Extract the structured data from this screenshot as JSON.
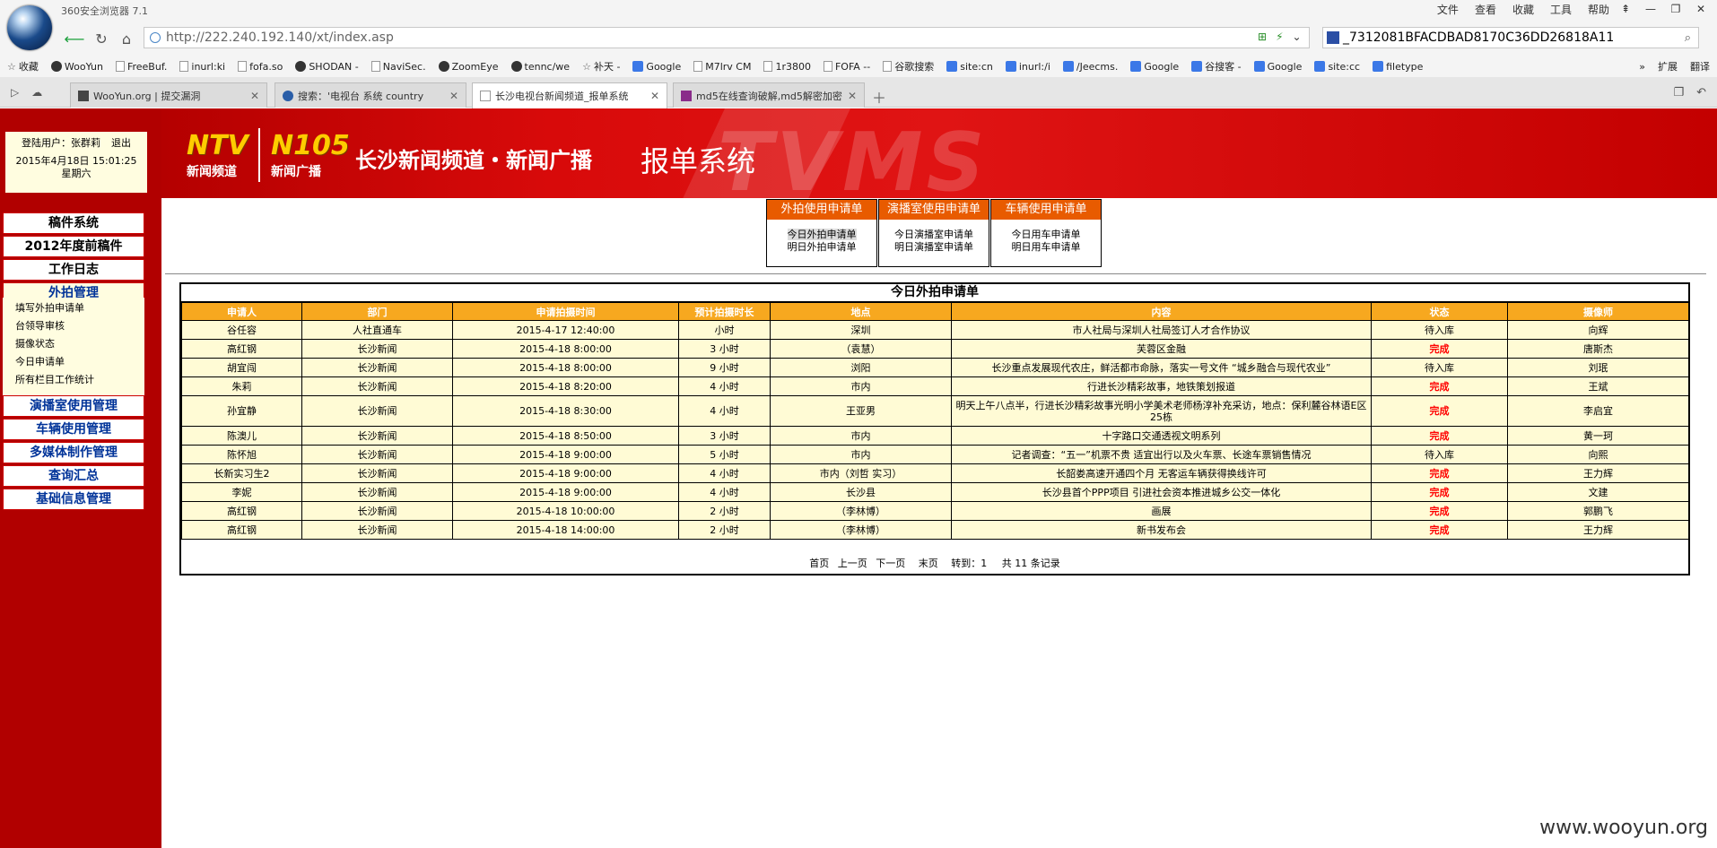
{
  "browser": {
    "title": "360安全浏览器 7.1",
    "menu": [
      "文件",
      "查看",
      "收藏",
      "工具",
      "帮助"
    ],
    "url": "http://222.240.192.140/xt/index.asp",
    "search_value": "_7312081BFACDBAD8170C36DD26818A11",
    "bookmarks": [
      {
        "label": "收藏",
        "icon": "star-icon"
      },
      {
        "label": "WooYun",
        "icon": "wooyun-icon"
      },
      {
        "label": "FreeBuf.",
        "icon": "freebuf-icon"
      },
      {
        "label": "inurl:ki",
        "icon": "page-icon"
      },
      {
        "label": "fofa.so",
        "icon": "page-icon"
      },
      {
        "label": "SHODAN -",
        "icon": "shodan-icon"
      },
      {
        "label": "NaviSec.",
        "icon": "page-icon"
      },
      {
        "label": "ZoomEye",
        "icon": "zoomeye-icon"
      },
      {
        "label": "tennc/we",
        "icon": "github-icon"
      },
      {
        "label": "补天 -",
        "icon": "butian-icon"
      },
      {
        "label": "Google",
        "icon": "google-icon"
      },
      {
        "label": "M7lrv CM",
        "icon": "page-icon"
      },
      {
        "label": "1r3800",
        "icon": "page-icon"
      },
      {
        "label": "FOFA --",
        "icon": "page-icon"
      },
      {
        "label": "谷歌搜索",
        "icon": "page-icon"
      },
      {
        "label": "site:cn",
        "icon": "google-icon"
      },
      {
        "label": "inurl:/i",
        "icon": "google-icon"
      },
      {
        "label": "/Jeecms.",
        "icon": "google-icon"
      },
      {
        "label": "Google",
        "icon": "google-icon"
      },
      {
        "label": "谷搜客 -",
        "icon": "google-icon"
      },
      {
        "label": "Google",
        "icon": "google-icon"
      },
      {
        "label": "site:cc",
        "icon": "google-icon"
      },
      {
        "label": "filetype",
        "icon": "google-icon"
      }
    ],
    "bookmarks_right": [
      "扩展",
      "翻译"
    ],
    "tabs": [
      {
        "label": "WooYun.org | 提交漏洞",
        "active": false
      },
      {
        "label": "搜索：'电视台 系统 country",
        "active": false
      },
      {
        "label": "长沙电视台新闻频道_报单系统",
        "active": true
      },
      {
        "label": "md5在线查询破解,md5解密加密",
        "active": false
      }
    ]
  },
  "banner": {
    "logo1_big": "NTV",
    "logo1_small": "新闻频道",
    "logo2_big": "N105",
    "logo2_small": "新闻广播",
    "title": "长沙新闻频道・新闻广播",
    "system": "报单系统",
    "watermark_text": "TVMS"
  },
  "sidebar": {
    "login_label": "登陆用户：张群莉",
    "logout": "退出",
    "date": "2015年4月18日 15:01:25",
    "weekday": "星期六",
    "menu_top": [
      "稿件系统",
      "2012年度前稿件",
      "工作日志"
    ],
    "waipai_header": "外拍管理",
    "waipai_items": [
      "填写外拍申请单",
      "台领导审核",
      "摄像状态",
      "今日申请单",
      "所有栏目工作统计"
    ],
    "menu_bottom": [
      "演播室使用管理",
      "车辆使用管理",
      "多媒体制作管理",
      "查询汇总",
      "基础信息管理"
    ]
  },
  "quick": [
    {
      "header": "外拍使用申请单",
      "links": [
        "今日外拍申请单",
        "明日外拍申请单"
      ]
    },
    {
      "header": "演播室使用申请单",
      "links": [
        "今日演播室申请单",
        "明日演播室申请单"
      ]
    },
    {
      "header": "车辆使用申请单",
      "links": [
        "今日用车申请单",
        "明日用车申请单"
      ]
    }
  ],
  "table": {
    "title": "今日外拍申请单",
    "columns": [
      "申请人",
      "部门",
      "申请拍摄时间",
      "预计拍摄时长",
      "地点",
      "内容",
      "状态",
      "摄像师"
    ],
    "rows": [
      [
        "谷任容",
        "人社直通车",
        "2015-4-17 12:40:00",
        "小时",
        "深圳",
        "市人社局与深圳人社局签订人才合作协议",
        "待入库",
        "向辉"
      ],
      [
        "高红钢",
        "长沙新闻",
        "2015-4-18 8:00:00",
        "3 小时",
        "（袁慧）",
        "芙蓉区金融",
        "完成",
        "唐斯杰"
      ],
      [
        "胡宜闯",
        "长沙新闻",
        "2015-4-18 8:00:00",
        "9 小时",
        "浏阳",
        "长沙重点发展现代农庄，鲜活都市命脉，落实一号文件 “城乡融合与现代农业”",
        "待入库",
        "刘珉"
      ],
      [
        "朱莉",
        "长沙新闻",
        "2015-4-18 8:20:00",
        "4 小时",
        "市内",
        "行进长沙精彩故事，地铁策划报道",
        "完成",
        "王斌"
      ],
      [
        "孙宜静",
        "长沙新闻",
        "2015-4-18 8:30:00",
        "4 小时",
        "王亚男",
        "明天上午八点半，行进长沙精彩故事光明小学美术老师杨淳补充采访，地点：保利麓谷林语E区25栋",
        "完成",
        "李启宜"
      ],
      [
        "陈澳儿",
        "长沙新闻",
        "2015-4-18 8:50:00",
        "3 小时",
        "市内",
        "十字路口交通透视文明系列",
        "完成",
        "黄一珂"
      ],
      [
        "陈怀旭",
        "长沙新闻",
        "2015-4-18 9:00:00",
        "5 小时",
        "市内",
        "记者调查：“五一”机票不贵 适宜出行以及火车票、长途车票销售情况",
        "待入库",
        "向熙"
      ],
      [
        "长新实习生2",
        "长沙新闻",
        "2015-4-18 9:00:00",
        "4 小时",
        "市内（刘哲 实习）",
        "长韶娄高速开通四个月 无客运车辆获得换线许可",
        "完成",
        "王力辉"
      ],
      [
        "李妮",
        "长沙新闻",
        "2015-4-18 9:00:00",
        "4 小时",
        "长沙县",
        "长沙县首个PPP项目 引进社会资本推进城乡公交一体化",
        "完成",
        "文建"
      ],
      [
        "高红钢",
        "长沙新闻",
        "2015-4-18 10:00:00",
        "2 小时",
        "（李林博）",
        "画展",
        "完成",
        "郭鹏飞"
      ],
      [
        "高红钢",
        "长沙新闻",
        "2015-4-18 14:00:00",
        "2 小时",
        "（李林博）",
        "新书发布会",
        "完成",
        "王力辉"
      ]
    ],
    "pager": {
      "first": "首页",
      "prev": "上一页",
      "next": "下一页",
      "last": "末页",
      "goto": "转到：1",
      "total": "共 11 条记录"
    }
  },
  "watermark": "www.wooyun.org",
  "colors": {
    "sidebar_red": "#b10000",
    "header_orange": "#f7a81f",
    "quick_header": "#e85b00",
    "done_red": "#ff0000",
    "row_bg": "#fffbd5"
  }
}
